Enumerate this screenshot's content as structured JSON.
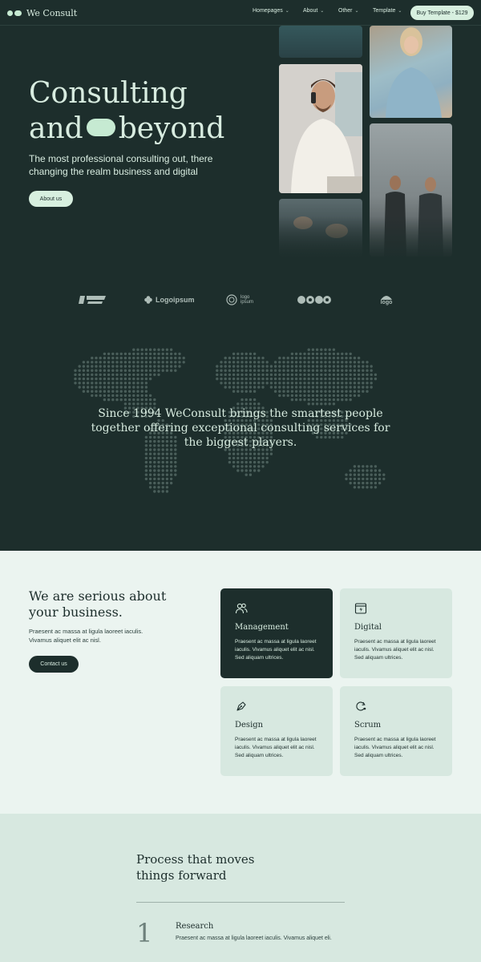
{
  "nav": {
    "brand": "We Consult",
    "menu": [
      {
        "label": "Homepages"
      },
      {
        "label": "About"
      },
      {
        "label": "Other"
      },
      {
        "label": "Template"
      }
    ],
    "cta": "Buy Template - $129"
  },
  "hero": {
    "title_line1": "Consulting",
    "title_line2a": "and",
    "title_line2b": "beyond",
    "subtitle": "The most professional consulting out, there changing the realm business and digital",
    "button": "About us"
  },
  "logos": [
    "Logoipsum",
    "logo ipsum",
    "logo"
  ],
  "statement": "Since 1994 WeConsult brings the smartest people together offering exceptional consulting services for the biggest players.",
  "services": {
    "title": "We are serious about your business.",
    "subtitle": "Praesent ac massa at ligula laoreet iaculis. Vivamus aliquet elit ac nisl.",
    "button": "Contact us",
    "cards": [
      {
        "title": "Management",
        "icon": "people-icon",
        "text": "Praesent ac massa at ligula laoreet iaculis. Vivamus aliquet elit ac nisl. Sed aliquam ultrices."
      },
      {
        "title": "Digital",
        "icon": "browser-bolt-icon",
        "text": "Praesent ac massa at ligula laoreet iaculis. Vivamus aliquet elit ac nisl. Sed aliquam ultrices."
      },
      {
        "title": "Design",
        "icon": "pen-nib-icon",
        "text": "Praesent ac massa at ligula laoreet iaculis. Vivamus aliquet elit ac nisl. Sed aliquam ultrices."
      },
      {
        "title": "Scrum",
        "icon": "cycle-arrows-icon",
        "text": "Praesent ac massa at ligula laoreet iaculis. Vivamus aliquet elit ac nisl. Sed aliquam ultrices."
      }
    ]
  },
  "process": {
    "title_line1": "Process that moves",
    "title_line2": "things forward",
    "steps": [
      {
        "number": "1",
        "title": "Research",
        "text": "Praesent ac massa at ligula laoreet iaculis. Vivamus aliquet eli."
      }
    ]
  },
  "colors": {
    "dark": "#1d2e2c",
    "accent": "#c6ead2",
    "light_bg": "#ebf4f0",
    "card_bg": "#d7e8e0"
  }
}
